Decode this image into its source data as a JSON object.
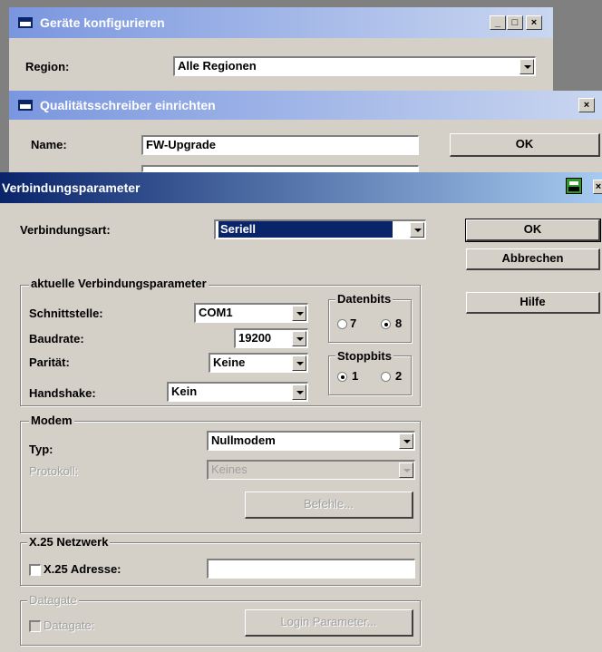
{
  "window1": {
    "title": "Geräte konfigurieren",
    "region_label": "Region:",
    "region_value": "Alle Regionen"
  },
  "window2": {
    "title": "Qualitätsschreiber einrichten",
    "name_label": "Name:",
    "name_value": "FW-Upgrade",
    "ok_label": "OK"
  },
  "dialog": {
    "title": "Verbindungsparameter",
    "close_glyph": "×",
    "verbindungsart_label": "Verbindungsart:",
    "verbindungsart_value": "Seriell",
    "ok_label": "OK",
    "cancel_label": "Abbrechen",
    "help_label": "Hilfe",
    "params": {
      "legend": "aktuelle Verbindungsparameter",
      "schnittstelle_label": "Schnittstelle:",
      "schnittstelle_value": "COM1",
      "baudrate_label": "Baudrate:",
      "baudrate_value": "19200",
      "paritaet_label": "Parität:",
      "paritaet_value": "Keine",
      "handshake_label": "Handshake:",
      "handshake_value": "Kein",
      "datenbits_legend": "Datenbits",
      "datenbits_options": [
        "7",
        "8"
      ],
      "datenbits_selected": "8",
      "stoppbits_legend": "Stoppbits",
      "stoppbits_options": [
        "1",
        "2"
      ],
      "stoppbits_selected": "1"
    },
    "modem": {
      "legend": "Modem",
      "typ_label": "Typ:",
      "typ_value": "Nullmodem",
      "protokoll_label": "Protokoll:",
      "protokoll_value": "Keines",
      "befehle_label": "Befehle..."
    },
    "x25": {
      "legend": "X.25 Netzwerk",
      "adresse_label": "X.25 Adresse:",
      "adresse_value": ""
    },
    "datagate": {
      "legend": "Datagate",
      "checkbox_label": "Datagate:",
      "login_label": "Login Parameter..."
    }
  },
  "colors": {
    "title_active": "#0a246a",
    "title_inactive": "#7a96df",
    "face": "#d4d0c8",
    "desktop": "#808080"
  }
}
